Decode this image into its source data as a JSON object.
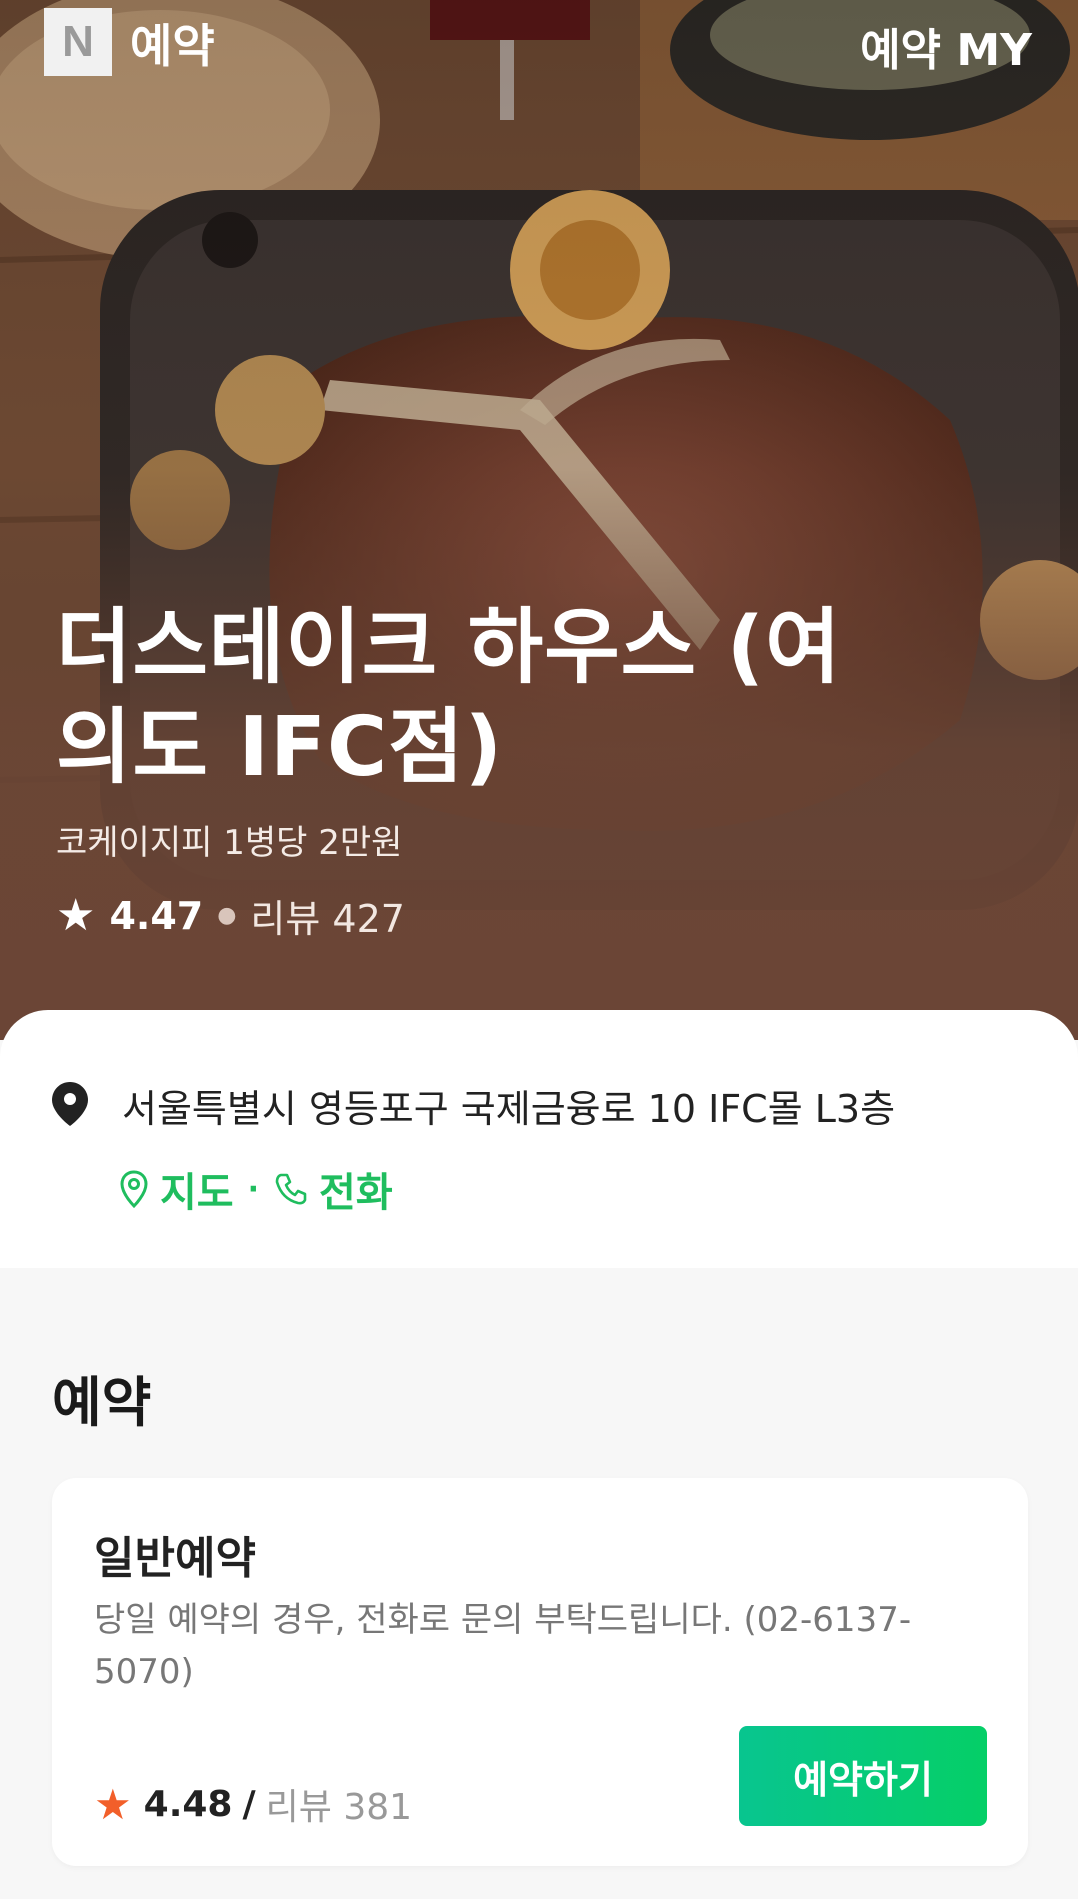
{
  "header": {
    "logo_letter": "N",
    "brand_label": "예약",
    "my_link": "예약 MY"
  },
  "store": {
    "name": "더스테이크 하우스 (여의도 IFC점)",
    "subtitle": "코케이지피 1병당 2만원",
    "rating": "4.47",
    "review_text": "리뷰 427"
  },
  "info": {
    "address": "서울특별시 영등포구 국제금융로 10 IFC몰 L3층",
    "map_label": "지도",
    "phone_label": "전화",
    "separator": "·"
  },
  "reservation": {
    "section_title": "예약",
    "type": "일반예약",
    "description": "당일 예약의 경우, 전화로 문의 부탁드립니다. (02-6137-5070)",
    "rating": "4.48",
    "slash": "/",
    "review_text": "리뷰 381",
    "book_button": "예약하기"
  },
  "colors": {
    "accent_green": "#1fbd5e",
    "button_green": "#05cf67",
    "hero_brown": "#6a4535",
    "star_orange": "#f25f2a"
  },
  "icons": [
    "location-pin-icon",
    "map-pin-outline-icon",
    "phone-icon",
    "star-icon"
  ]
}
